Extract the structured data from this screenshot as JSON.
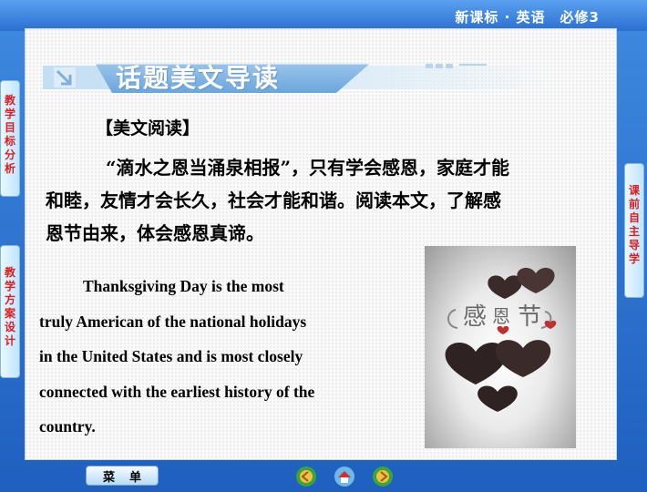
{
  "header": {
    "course": "新课标 · 英语　必修3"
  },
  "sidebar_left": [
    {
      "label": "教学目标分析"
    },
    {
      "label": "教学方案设计"
    }
  ],
  "sidebar_right": [
    {
      "label": "课前自主导学"
    }
  ],
  "banner": {
    "title": "话题美文导读"
  },
  "section": {
    "heading": "【美文阅读】"
  },
  "intro": {
    "line1": "“滴水之恩当涌泉相报”，只有学会感恩，家庭才能",
    "line2": "和睦，友情才会长久，社会才能和谐。阅读本文，了解感",
    "line3": "恩节由来，体会感恩真谛。"
  },
  "passage": {
    "lines": [
      "Thanksgiving Day is the most",
      "truly American of the national holidays",
      "in the United States and is most closely",
      "connected with the earliest history of the",
      "country."
    ]
  },
  "image": {
    "text": "感恩节",
    "icon": "thanksgiving-hearts-image"
  },
  "footer": {
    "menu_left": "菜",
    "menu_right": "单",
    "nav": [
      "prev-icon",
      "home-icon",
      "next-icon"
    ]
  },
  "colors": {
    "accent": "#2a6fc9",
    "tab_text": "#e01c1c",
    "banner": "#6aa6dd"
  }
}
